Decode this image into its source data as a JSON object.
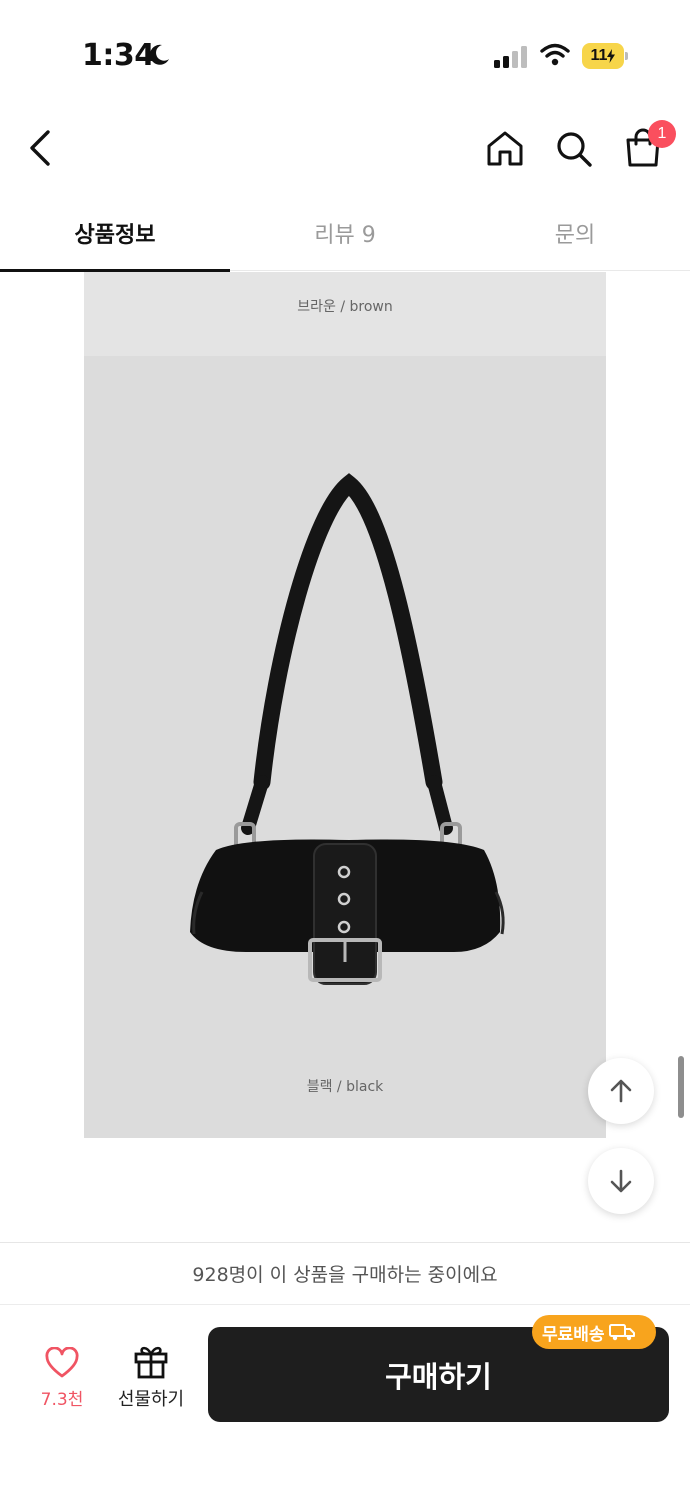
{
  "status_bar": {
    "time": "1:34",
    "battery": "11"
  },
  "nav": {
    "cart_badge": "1"
  },
  "tabs": [
    {
      "label": "상품정보",
      "active": true
    },
    {
      "label": "리뷰 9",
      "active": false
    },
    {
      "label": "문의",
      "active": false
    }
  ],
  "content": {
    "variant_top": "브라운 / brown",
    "variant_bottom": "블랙 / black"
  },
  "bottom": {
    "buyers_text": "928명이 이 상품을 구매하는 중이에요",
    "like_count": "7.3천",
    "gift_label": "선물하기",
    "buy_label": "구매하기",
    "free_shipping_label": "무료배송"
  },
  "colors": {
    "accent_red": "#fa4f5e",
    "badge_orange": "#f8a41d",
    "buy_button": "#1e1e1e"
  }
}
